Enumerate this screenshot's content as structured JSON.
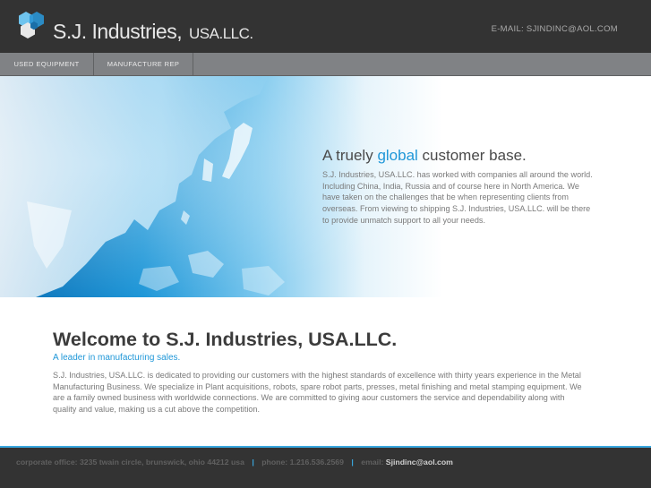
{
  "header": {
    "company_name": "S.J. Industries,",
    "company_suffix": "USA.LLC.",
    "email": "E-MAIL: SJINDINC@AOL.COM"
  },
  "nav": {
    "items": [
      {
        "label": "USED EQUIPMENT"
      },
      {
        "label": "MANUFACTURE REP"
      }
    ]
  },
  "hero": {
    "title_pre": "A truely",
    "title_highlight": "global",
    "title_post": "customer base.",
    "body": "S.J. Industries, USA.LLC. has worked with companies all around the world. Including China, India, Russia and of course here in North America. We have taken on the challenges that be when representing clients from overseas. From viewing to shipping S.J. Industries, USA.LLC. will be there to provide unmatch support to all your needs."
  },
  "main": {
    "title": "Welcome to S.J. Industries, USA.LLC.",
    "subtitle": "A leader in manufacturing sales.",
    "body": "S.J. Industries, USA.LLC. is dedicated to providing our customers with the highest standards of excellence with thirty years experience in the Metal Manufacturing Business. We specialize in Plant acquisitions, robots, spare robot parts, presses, metal finishing and metal stamping equipment. We are a family owned business with worldwide connections. We are committed to giving aour customers the service and dependability along with quality and value, making us a cut above the competition."
  },
  "footer": {
    "office": "corporate office: 3235 twain circle, brunswick, ohio 44212 usa",
    "sep": "|",
    "phone": "phone: 1.216.536.2569",
    "email_label": "email:",
    "email": "Sjindinc@aol.com"
  },
  "colors": {
    "accent": "#39a8e0",
    "header_bg": "#333333",
    "nav_bg": "#808285"
  }
}
